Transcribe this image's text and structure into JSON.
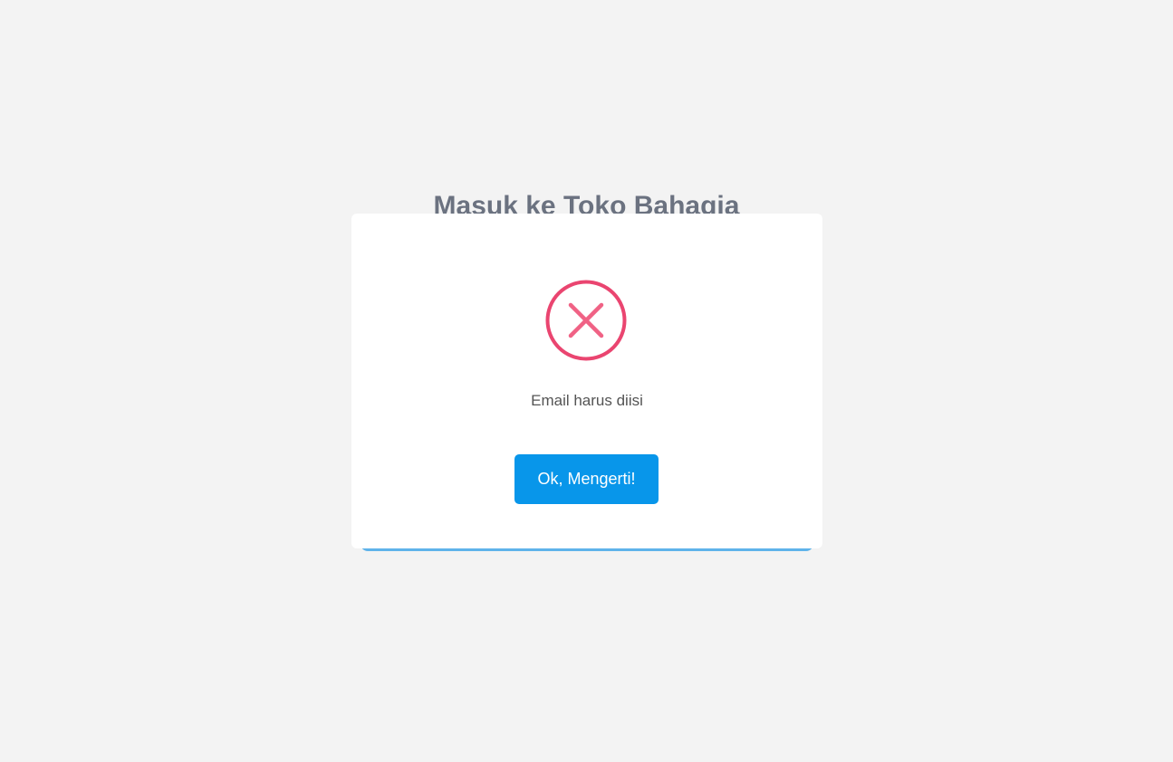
{
  "page": {
    "title": "Masuk ke Toko Bahagia"
  },
  "dialog": {
    "icon": "error-x-icon",
    "message": "Email harus diisi",
    "confirm_label": "Ok, Mengerti!"
  },
  "colors": {
    "background": "#f3f3f3",
    "error": "#f06285",
    "error_ring": "#ea4570",
    "button": "#0896ea",
    "accent_bar": "#5fb3ea",
    "title": "#6b7280",
    "message_text": "#545454"
  }
}
